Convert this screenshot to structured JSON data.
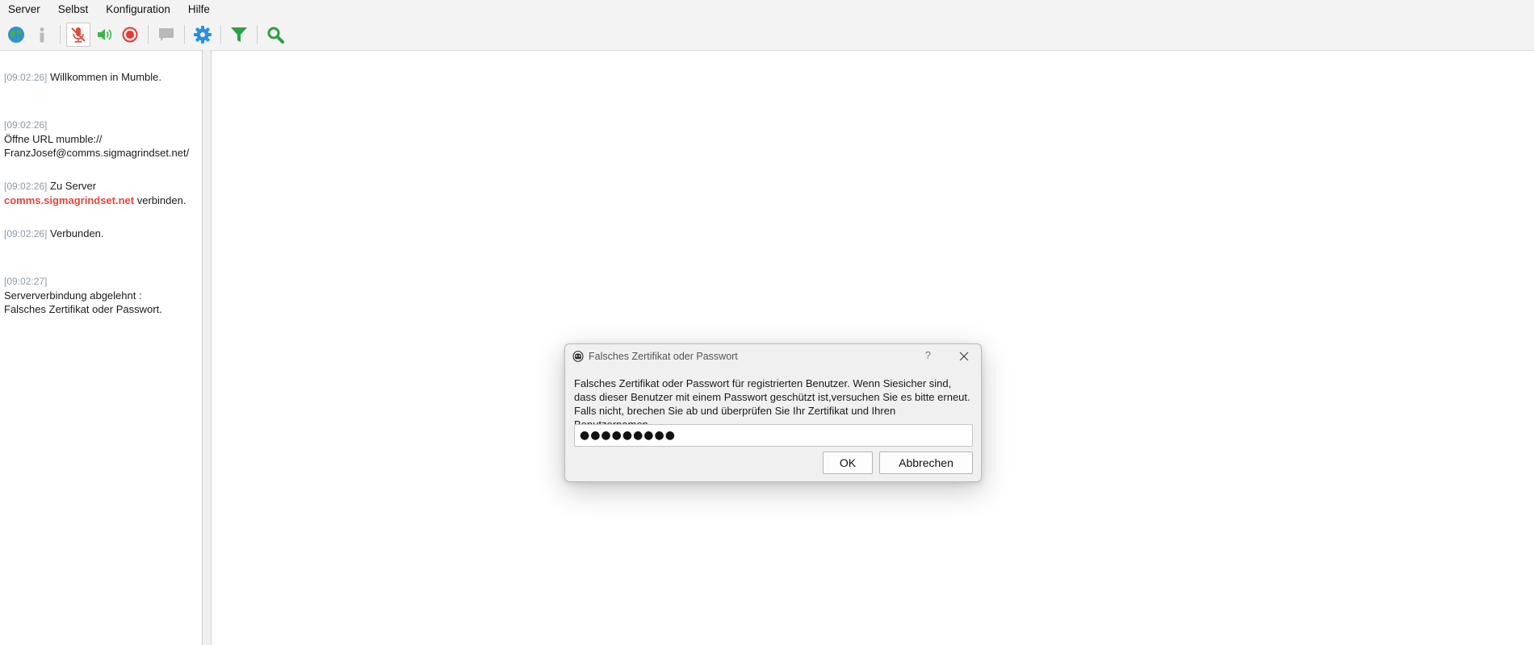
{
  "menu": {
    "items": [
      "Server",
      "Selbst",
      "Konfiguration",
      "Hilfe"
    ]
  },
  "toolbar": {
    "icons": [
      "globe-icon",
      "info-icon",
      "microphone-muted-icon",
      "speaker-icon",
      "record-icon",
      "chat-icon",
      "gear-icon",
      "filter-icon",
      "search-icon"
    ],
    "colors": {
      "globe": "#2f8fd8",
      "muted": "#e24b3b",
      "speaker": "#3bb54a",
      "record": "#e53935",
      "gear": "#2b8fe0",
      "filter": "#2e9e44",
      "search": "#2e9e44"
    }
  },
  "log": {
    "entries": [
      {
        "time": "[09:02:26]",
        "text": "Willkommen in Mumble."
      },
      {
        "time": "[09:02:26]",
        "text": "Öffne URL mumble://\nFranzJosef@comms.sigmagrindset.net/"
      },
      {
        "time": "[09:02:26]",
        "text_before": "Zu Server",
        "link": "comms.sigmagrindset.net",
        "text_after": "verbinden."
      },
      {
        "time": "[09:02:26]",
        "text": "Verbunden."
      },
      {
        "time": "[09:02:27]",
        "text": "Serververbindung abgelehnt :\nFalsches Zertifikat oder Passwort."
      }
    ]
  },
  "dialog": {
    "title": "Falsches Zertifikat oder Passwort",
    "help": "?",
    "message_line1": "Falsches Zertifikat oder Passwort für registrierten Benutzer. Wenn Siesicher sind,",
    "message_line2": "dass dieser Benutzer mit einem Passwort geschützt ist,versuchen Sie es bitte erneut.",
    "message_line3": "Falls nicht, brechen Sie ab und überprüfen Sie Ihr Zertifikat und Ihren Benutzernamen.",
    "password_value": "●●●●●●●●●",
    "ok_label": "OK",
    "cancel_label": "Abbrechen"
  }
}
